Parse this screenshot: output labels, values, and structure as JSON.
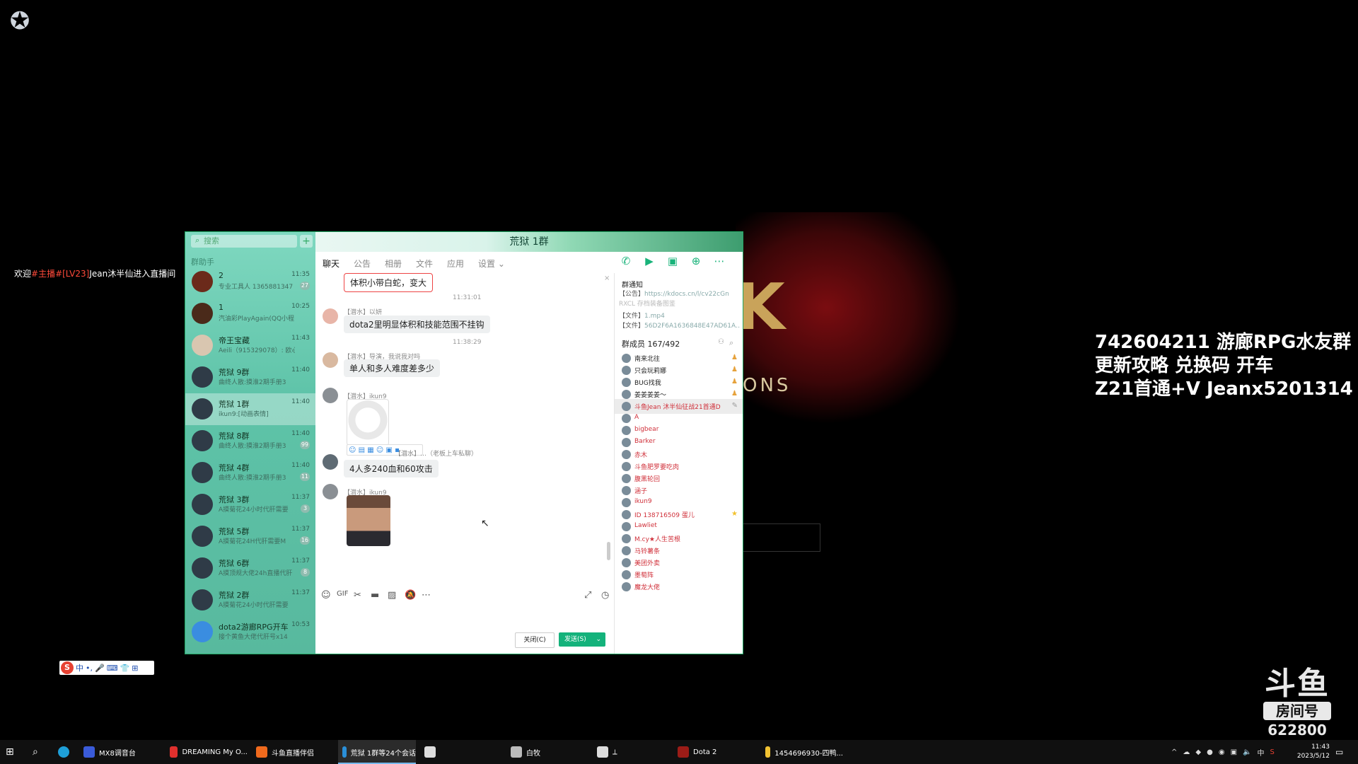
{
  "desktop": {
    "welcome": {
      "prefix": "欢迎",
      "highlight": "#主播#[LV23]",
      "suffix": "Jean沐半仙进入直播间"
    },
    "overlay_lines": [
      "742604211 游廊RPG水友群",
      "更新攻略 兑换码 开车",
      "Z21首通+V Jeanx5201314"
    ],
    "art_text": "ONS",
    "douyu": {
      "logo": "斗鱼",
      "room_label": "房间号",
      "room_number": "622800"
    },
    "ime": {
      "labels": [
        "中",
        "•,",
        "🎤",
        "⌨",
        "👕",
        "⊞"
      ]
    }
  },
  "qq": {
    "title": "荒狱 1群",
    "search_placeholder": "搜索",
    "assistant_label": "群助手",
    "conversations": [
      {
        "name": "2",
        "preview": "专业工具人 1365881347",
        "time": "11:35",
        "badge": "27"
      },
      {
        "name": "1",
        "preview": "汽油彩PlayAgain(QQ小程",
        "time": "10:25",
        "badge": ""
      },
      {
        "name": "帝王宝藏",
        "preview": "Aeili（915329078）: 欧心",
        "time": "11:43",
        "badge": ""
      },
      {
        "name": "荒狱 9群",
        "preview": "曲终人散:摸淮2期手册3",
        "time": "11:40",
        "badge": ""
      },
      {
        "name": "荒狱 1群",
        "preview": "ikun9:[动画表情]",
        "time": "11:40",
        "badge": ""
      },
      {
        "name": "荒狱 8群",
        "preview": "曲终人散:摸淮2期手册3",
        "time": "11:40",
        "badge": "99"
      },
      {
        "name": "荒狱 4群",
        "preview": "曲终人散:摸淮2期手册3",
        "time": "11:40",
        "badge": "11"
      },
      {
        "name": "荒狱 3群",
        "preview": "A摸菊花24小时代肝需要",
        "time": "11:37",
        "badge": "3"
      },
      {
        "name": "荒狱 5群",
        "preview": "A摸菊花24H代肝需要M",
        "time": "11:37",
        "badge": "16"
      },
      {
        "name": "荒狱 6群",
        "preview": "A摸顶规大佬24h直播代肝",
        "time": "11:37",
        "badge": "8"
      },
      {
        "name": "荒狱 2群",
        "preview": "A摸菊花24小时代肝需要",
        "time": "11:37",
        "badge": ""
      },
      {
        "name": "dota2游廊RPG开车",
        "preview": "接个黄鱼大佬代肝号x14",
        "time": "10:53",
        "badge": ""
      }
    ],
    "tabs": [
      "聊天",
      "公告",
      "相册",
      "文件",
      "应用",
      "设置 ⌄"
    ],
    "messages": {
      "top_bubble": "体积小带白蛇，变大",
      "t1": "11:31:01",
      "m1_role": "【潜水】以妍",
      "m1_text": "dota2里明显体积和技能范围不挂钩",
      "t2": "11:38:29",
      "m2_role": "【潜水】导演，我说我对吗",
      "m2_text": "单人和多人难度差多少",
      "m3_role": "【潜水】ikun9",
      "m4_role": "【潜水】…（老板上车私聊）",
      "m4_text": "4人多240血和60攻击",
      "m5_role": "【潜水】ikun9"
    },
    "buttons": {
      "close": "关闭(C)",
      "send": "发送(S)"
    },
    "right": {
      "notice_title": "群通知",
      "notice_1_tag": "【公告】",
      "notice_1_link": "https://kdocs.cn/l/cv22cGn",
      "notice_1b": "RXCL 存档装备图鉴",
      "notice_2_tag": "【文件】",
      "notice_2_link": "1.mp4",
      "notice_3_tag": "【文件】",
      "notice_3_link": "56D2F6A1636848E47AD61A…",
      "members_title": "群成员 167/492",
      "members": [
        {
          "name": "南来北往",
          "color": "#222",
          "badge": "owner"
        },
        {
          "name": "只会玩莉娜",
          "color": "#222",
          "badge": "owner"
        },
        {
          "name": "BUG找我",
          "color": "#222",
          "badge": "owner"
        },
        {
          "name": "姜姜姜姜～",
          "color": "#222",
          "badge": "owner"
        },
        {
          "name": "斗鱼Jean 沐半仙征战21首通D",
          "color": "#d0303a",
          "badge": "edit"
        },
        {
          "name": "A",
          "color": "#d0303a",
          "badge": ""
        },
        {
          "name": "bigbear",
          "color": "#d0303a",
          "badge": ""
        },
        {
          "name": "Barker",
          "color": "#d0303a",
          "badge": ""
        },
        {
          "name": "赤木",
          "color": "#d0303a",
          "badge": ""
        },
        {
          "name": "斗鱼肥罗要吃肉",
          "color": "#d0303a",
          "badge": ""
        },
        {
          "name": "腹黑轮回",
          "color": "#d0303a",
          "badge": ""
        },
        {
          "name": "涵子",
          "color": "#d0303a",
          "badge": ""
        },
        {
          "name": "ikun9",
          "color": "#d0303a",
          "badge": ""
        },
        {
          "name": "ID 138716509 蛋儿",
          "color": "#d0303a",
          "badge": "star"
        },
        {
          "name": "Lawliet",
          "color": "#d0303a",
          "badge": ""
        },
        {
          "name": "M.cy★人生苦根",
          "color": "#d0303a",
          "badge": ""
        },
        {
          "name": "马铃薯条",
          "color": "#d0303a",
          "badge": ""
        },
        {
          "name": "美团外卖",
          "color": "#d0303a",
          "badge": ""
        },
        {
          "name": "墨萄阵",
          "color": "#d0303a",
          "badge": ""
        },
        {
          "name": "魔龙大佬",
          "color": "#d0303a",
          "badge": ""
        }
      ]
    }
  },
  "taskbar": {
    "items": [
      {
        "label": "MX8调音台",
        "color": "#3a5bd9"
      },
      {
        "label": "DREAMING My O...",
        "color": "#e0302d"
      },
      {
        "label": "斗鱼直播伴侣",
        "color": "#f06a1d"
      },
      {
        "label": "荒狱 1群等24个会话",
        "color": "#2a8fd8"
      },
      {
        "label": "",
        "color": "#ddd"
      },
      {
        "label": "白牧",
        "color": "#bbb"
      },
      {
        "label": "⟂",
        "color": "#ddd"
      },
      {
        "label": "Dota 2",
        "color": "#9b1c17"
      },
      {
        "label": "1454696930-四鸭...",
        "color": "#f1c232"
      }
    ],
    "time": "11:43",
    "date": "2023/5/12",
    "ime_indicator": "中"
  }
}
